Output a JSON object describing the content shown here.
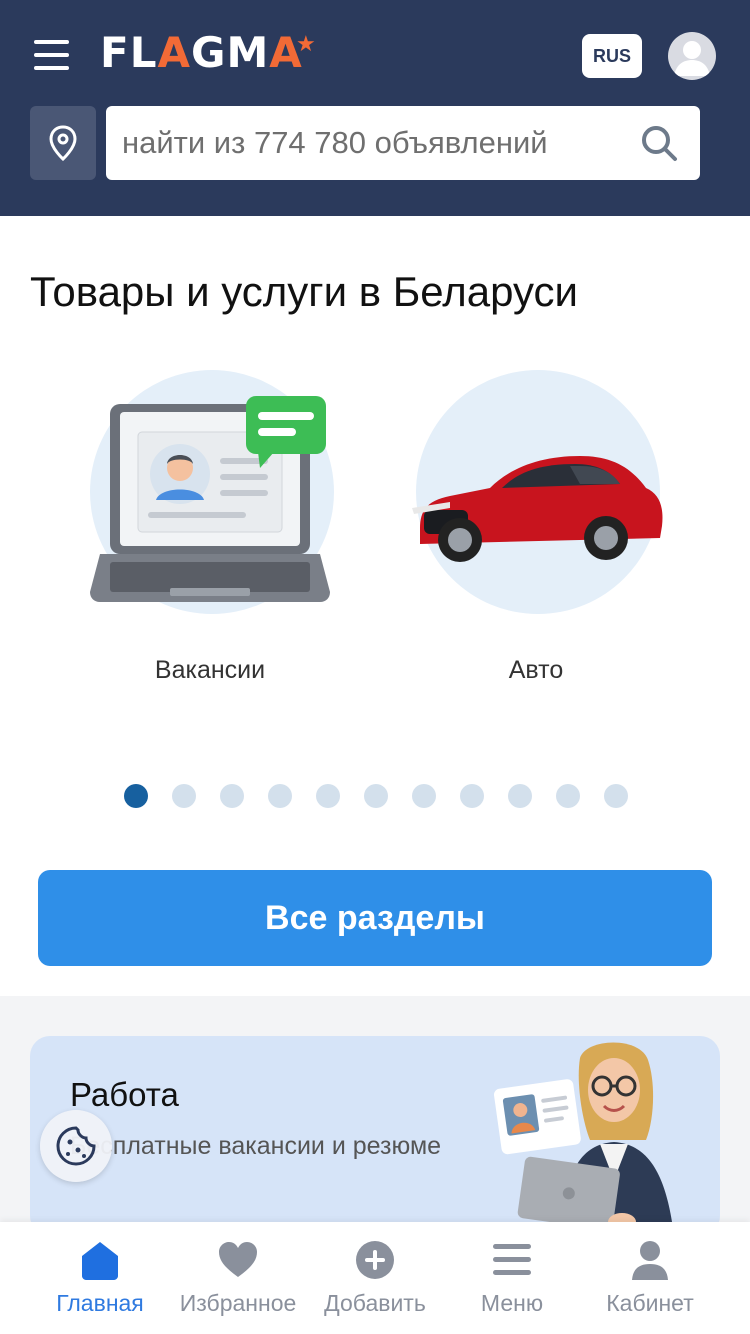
{
  "header": {
    "logo_part1": "FL",
    "logo_a1": "A",
    "logo_part2": "GM",
    "logo_a2": "A",
    "lang": "RUS",
    "search_placeholder": "найти из 774 780 объявлений",
    "icons": [
      "menu-icon",
      "location-icon",
      "search-icon",
      "user-icon"
    ]
  },
  "main": {
    "title": "Товары и услуги в Беларуси",
    "categories": [
      {
        "label": "Вакансии",
        "icon": "laptop-resume-illustration"
      },
      {
        "label": "Авто",
        "icon": "red-car-illustration"
      }
    ],
    "carousel_dots": 11,
    "active_dot": 0,
    "all_sections_button": "Все разделы"
  },
  "promo": {
    "title": "Работа",
    "subtitle": "Бесплатные вакансии и резюме",
    "illustration": "woman-with-laptop-illustration"
  },
  "bottom_nav": {
    "items": [
      {
        "label": "Главная",
        "icon": "home-icon",
        "active": true
      },
      {
        "label": "Избранное",
        "icon": "heart-icon",
        "active": false
      },
      {
        "label": "Добавить",
        "icon": "plus-circle-icon",
        "active": false
      },
      {
        "label": "Меню",
        "icon": "menu-icon",
        "active": false
      },
      {
        "label": "Кабинет",
        "icon": "user-icon",
        "active": false
      }
    ]
  },
  "colors": {
    "header_bg": "#2b3a5c",
    "accent_orange": "#f26a36",
    "primary_blue": "#2f8fe8",
    "active_dot": "#17609f",
    "nav_active": "#2f7ae0"
  }
}
